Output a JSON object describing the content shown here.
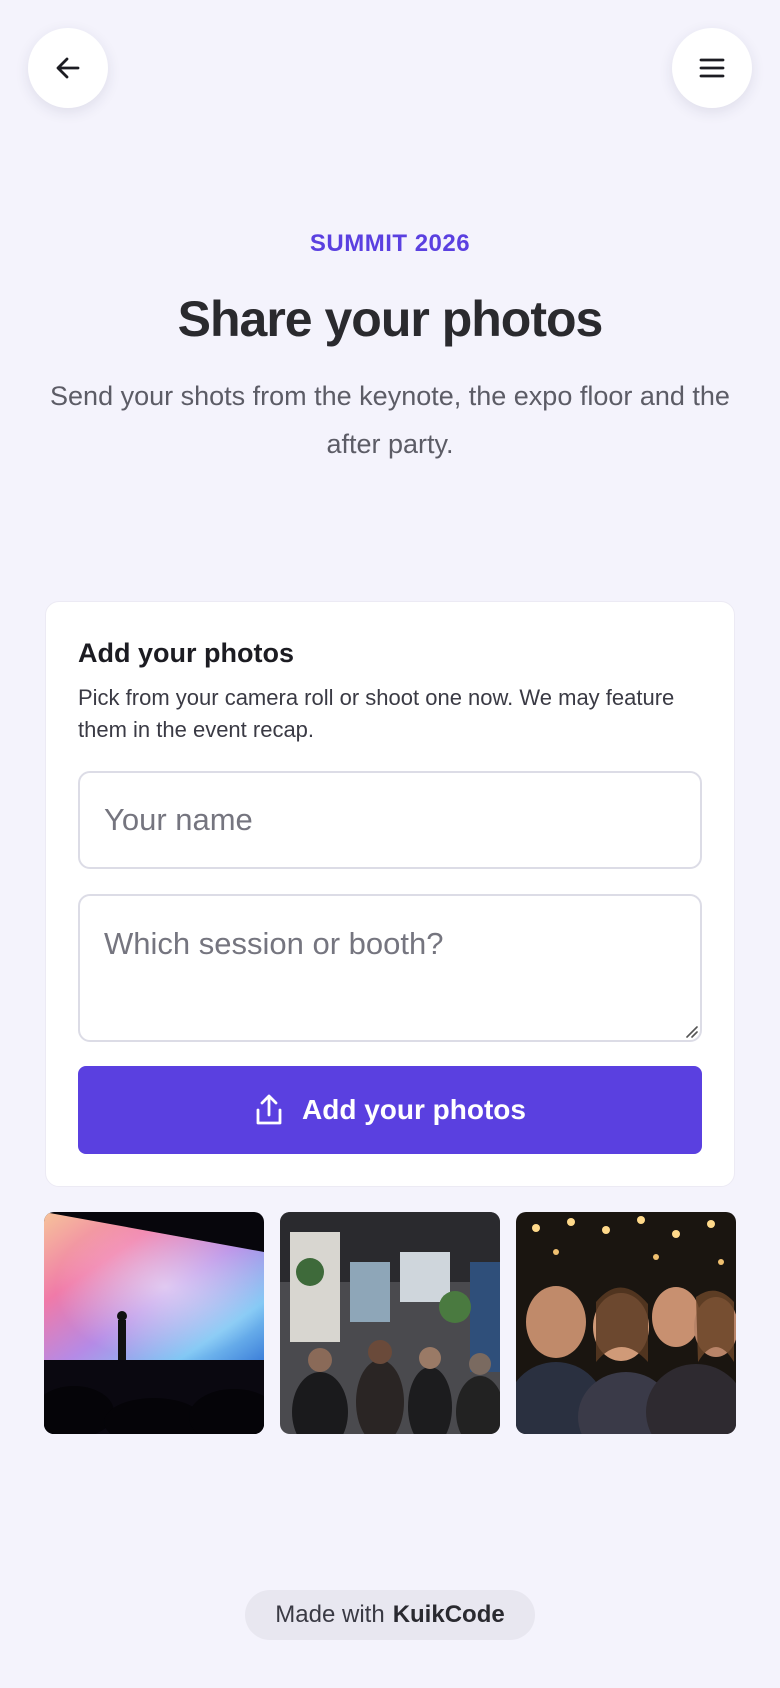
{
  "header": {
    "back_icon": "arrow-left-icon",
    "menu_icon": "hamburger-menu-icon"
  },
  "hero": {
    "eyebrow": "SUMMIT 2026",
    "title": "Share your photos",
    "subtitle": "Send your shots from the keynote, the expo floor and the after party."
  },
  "upload_card": {
    "title": "Add your photos",
    "description": "Pick from your camera roll or shoot one now. We may feature them in the event recap.",
    "name_placeholder": "Your name",
    "name_value": "",
    "session_placeholder": "Which session or booth?",
    "session_value": "",
    "button_label": "Add your photos",
    "button_icon": "upload-icon"
  },
  "gallery": {
    "photos": [
      {
        "subject": "keynote-stage"
      },
      {
        "subject": "expo-floor-crowd"
      },
      {
        "subject": "after-party-selfie"
      }
    ]
  },
  "footer": {
    "made_with": "Made with",
    "brand": "KuikCode"
  },
  "colors": {
    "accent": "#5a40e0",
    "background": "#f4f3fc",
    "card": "#ffffff"
  }
}
